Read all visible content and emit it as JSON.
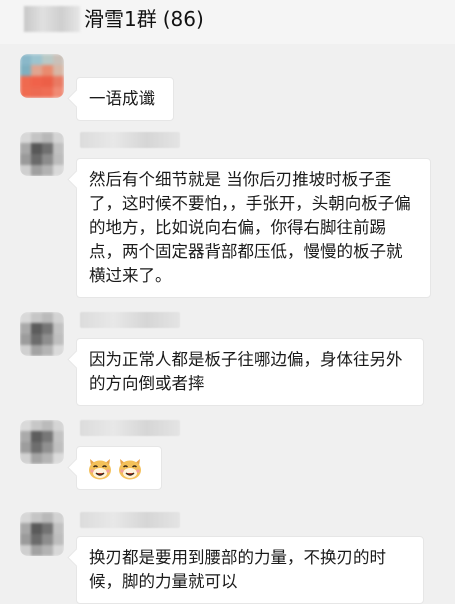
{
  "header": {
    "title": "滑雪1群",
    "count": "(86)"
  },
  "messages": [
    {
      "text": "一语成谶"
    },
    {
      "text": "然后有个细节就是 当你后刃推坡时板子歪了，这时候不要怕，，手张开，头朝向板子偏的地方，比如说向右偏，你得右脚往前踢点，两个固定器背部都压低，慢慢的板子就横过来了。"
    },
    {
      "text": "因为正常人都是板子往哪边偏，身体往另外的方向倒或者摔"
    },
    {
      "emoji": [
        "cat-face-icon",
        "cat-face-icon"
      ]
    },
    {
      "text": "换刃都是要用到腰部的力量，不换刃的时候，脚的力量就可以"
    }
  ],
  "colors": {
    "background": "#f0f0f0",
    "bubble": "#ffffff",
    "text": "#1a1a1a"
  }
}
